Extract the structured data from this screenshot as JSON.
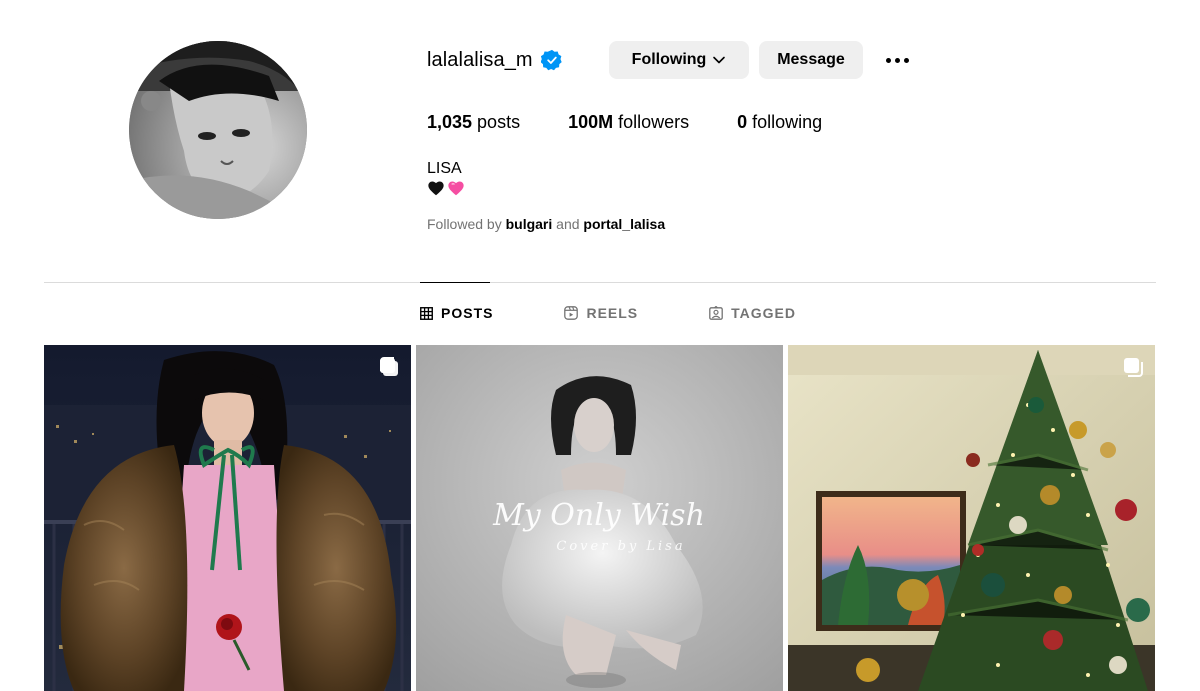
{
  "profile": {
    "username": "lalalalisa_m",
    "verified_icon": "verified-badge-icon",
    "following_label": "Following",
    "message_label": "Message",
    "stats": {
      "posts_count": "1,035",
      "posts_label": "posts",
      "followers_count": "100M",
      "followers_label": "followers",
      "following_count": "0",
      "following_label": "following"
    },
    "full_name": "LISA",
    "bio_emojis": [
      "black-heart",
      "pink-heart"
    ],
    "followed_by_prefix": "Followed by",
    "followed_by_1": "bulgari",
    "followed_by_and": "and",
    "followed_by_2": "portal_lalisa"
  },
  "tabs": [
    {
      "label": "POSTS",
      "active": true,
      "icon": "grid-icon"
    },
    {
      "label": "REELS",
      "active": false,
      "icon": "reels-icon"
    },
    {
      "label": "TAGGED",
      "active": false,
      "icon": "tagged-icon"
    }
  ],
  "posts": [
    {
      "type": "carousel",
      "icon": "multiple-posts-icon"
    },
    {
      "type": "single",
      "overlay_title": "My Only Wish",
      "overlay_subtitle": "Cover by Lisa"
    },
    {
      "type": "carousel",
      "icon": "multiple-posts-icon"
    }
  ],
  "colors": {
    "button_bg": "#efefef",
    "verified_blue": "#0095f6",
    "muted_text": "#737373",
    "divider": "#dbdbdb"
  }
}
